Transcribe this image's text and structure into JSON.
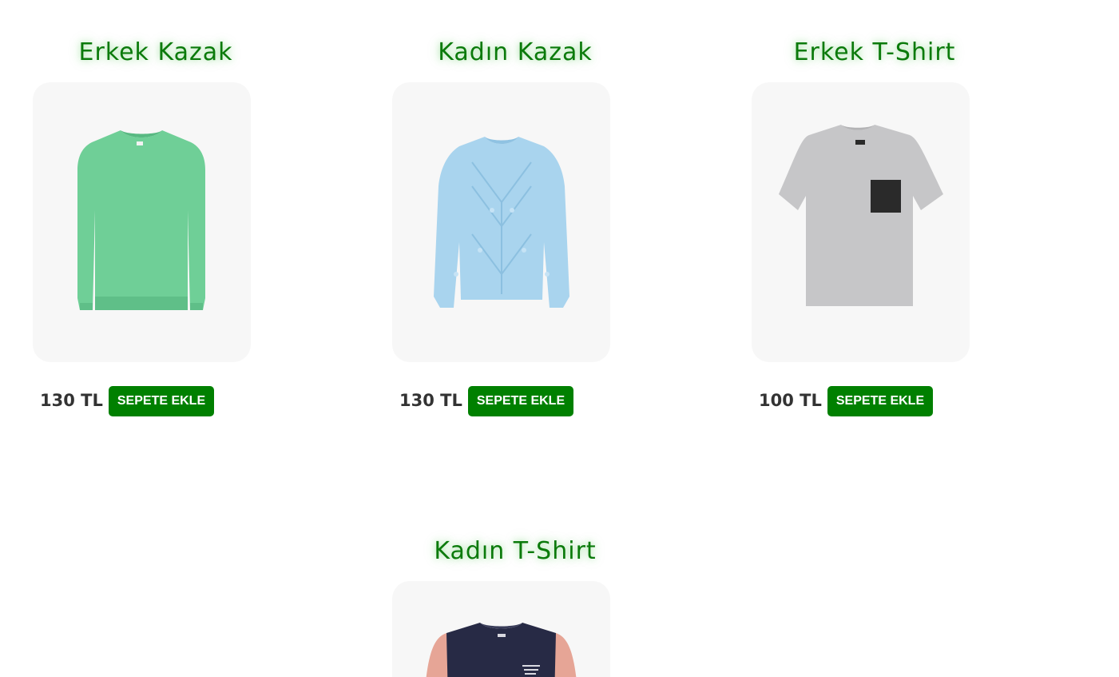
{
  "products": [
    {
      "title": "Erkek Kazak",
      "price": "130 TL",
      "button_label": "SEPETE EKLE",
      "image": "green-knit-sweater",
      "color": "#6fcf97"
    },
    {
      "title": "Kadın Kazak",
      "price": "130 TL",
      "button_label": "SEPETE EKLE",
      "image": "light-blue-cable-knit-sweater",
      "color": "#a9d4ee"
    },
    {
      "title": "Erkek T-Shirt",
      "price": "100 TL",
      "button_label": "SEPETE EKLE",
      "image": "grey-tshirt-with-black-pocket",
      "color": "#c6c6c8"
    },
    {
      "title": "Kadın T-Shirt",
      "image": "navy-pink-colorblock-tshirt",
      "color": "#272a45"
    }
  ],
  "colors": {
    "title_green": "#0b7a0b",
    "button_green": "#008000",
    "card_bg": "#f7f7f7"
  }
}
